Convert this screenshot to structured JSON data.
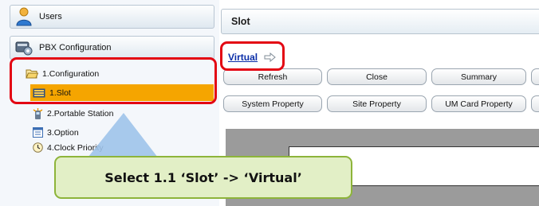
{
  "sidebar": {
    "users_label": "Users",
    "pbx_label": "PBX Configuration",
    "tree": [
      {
        "label": "1.Configuration",
        "icon": "folder-open-icon"
      },
      {
        "label": "1.Slot",
        "icon": "slot-icon",
        "selected": true
      },
      {
        "label": "2.Portable Station",
        "icon": "portable-station-icon"
      },
      {
        "label": "3.Option",
        "icon": "option-icon"
      },
      {
        "label": "4.Clock Priority",
        "icon": "clock-priority-icon"
      }
    ]
  },
  "main": {
    "title": "Slot",
    "virtual_link": "Virtual",
    "toolbar_row1": [
      "Refresh",
      "Close",
      "Summary"
    ],
    "toolbar_row2": [
      "System Property",
      "Site Property",
      "UM Card Property"
    ]
  },
  "callout": {
    "text": "Select 1.1 ‘Slot’ -> ‘Virtual’"
  },
  "colors": {
    "selection": "#f5a500",
    "highlight_red": "#e30613",
    "callout_fill": "#e2efc6",
    "callout_border": "#8db43a",
    "link": "#0b2ea8"
  }
}
